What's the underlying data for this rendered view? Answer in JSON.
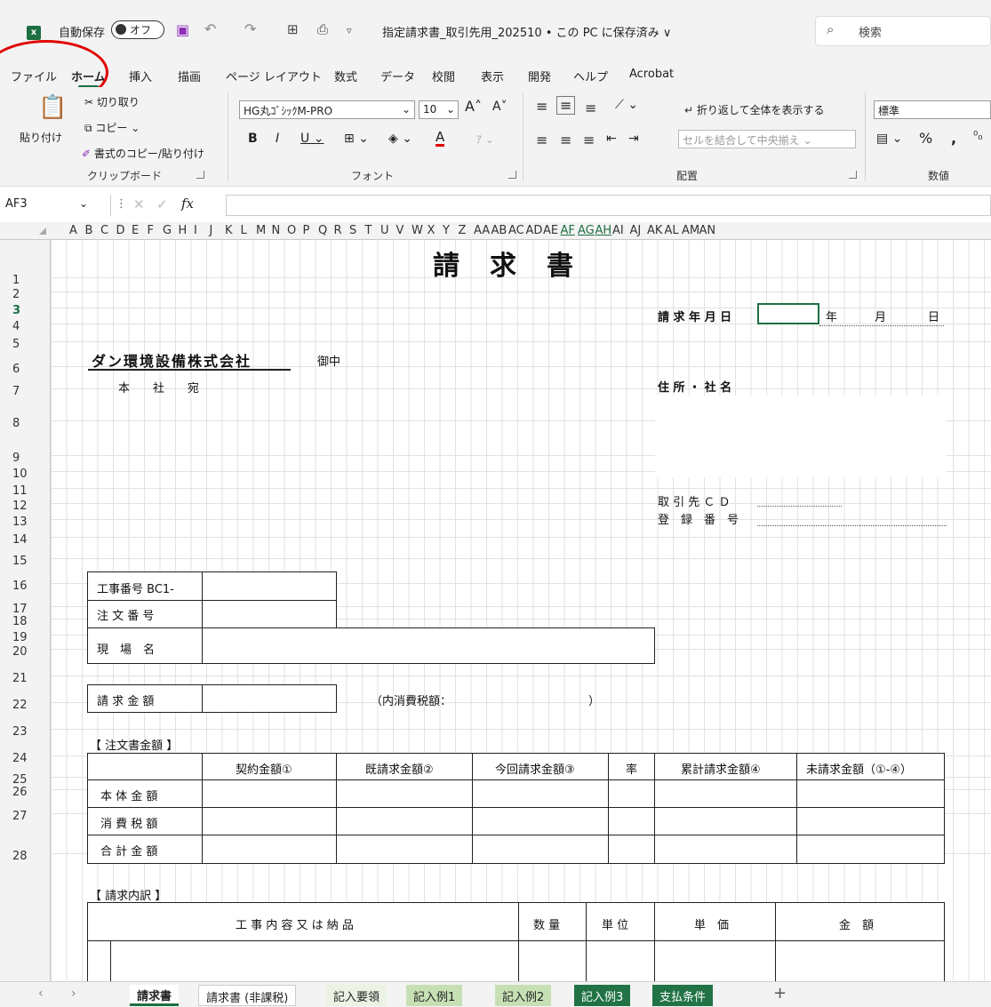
{
  "titlebar": {
    "autosave": "自動保存",
    "toggle": "オフ",
    "filename": "指定請求書_取引先用_202510 • この PC に保存済み ∨",
    "search": "検索"
  },
  "menu": [
    "ファイル",
    "ホーム",
    "挿入",
    "描画",
    "ページ レイアウト",
    "数式",
    "データ",
    "校閲",
    "表示",
    "開発",
    "ヘルプ",
    "Acrobat"
  ],
  "ribbon": {
    "paste": "貼り付け",
    "cut": "切り取り",
    "copy": "コピー",
    "format_painter": "書式のコピー/貼り付け",
    "clipboard": "クリップボード",
    "font_name": "HG丸ｺﾞｼｯｸM-PRO",
    "font_size": "10",
    "font_group": "フォント",
    "wrap": "折り返して全体を表示する",
    "merge": "セルを結合して中央揃え",
    "align_group": "配置",
    "number_format": "標準",
    "number_group": "数値"
  },
  "namebox": "AF3",
  "columns": [
    "A",
    "B",
    "C",
    "D",
    "E",
    "F",
    "G",
    "H",
    "I",
    "J",
    "K",
    "L",
    "M",
    "N",
    "O",
    "P",
    "Q",
    "R",
    "S",
    "T",
    "U",
    "V",
    "W",
    "X",
    "Y",
    "Z",
    "AA",
    "AB",
    "AC",
    "AD",
    "AE",
    "AF",
    "AG",
    "AH",
    "AI",
    "AJ",
    "AK",
    "AL",
    "AM",
    "AN"
  ],
  "rows": [
    "1",
    "2",
    "3",
    "4",
    "5",
    "6",
    "7",
    "8",
    "9",
    "10",
    "11",
    "12",
    "13",
    "14",
    "15",
    "16",
    "17",
    "18",
    "19",
    "20",
    "21",
    "22",
    "23",
    "24",
    "25",
    "26",
    "27",
    "28"
  ],
  "sheet": {
    "title": "請　求　書",
    "date_label": "請 求 年 月 日",
    "year": "年",
    "month": "月",
    "day": "日",
    "company": "ダン環境設備株式会社",
    "onchu": "御中",
    "honsha": "本　　社　　宛",
    "address_label": "住 所 ・ 社 名",
    "partner_cd": "取 引 先 Ｃ Ｄ",
    "reg_no": "登　録　番　号",
    "koji_no": "工事番号 BC1-",
    "order_no": "注 文 番 号",
    "site": "現　場　名",
    "amount": "請 求 金 額",
    "tax_note": "（内消費税額：",
    "tax_close": "）",
    "order_section": "【 注文書金額 】",
    "order_headers": [
      "契約金額①",
      "既請求金額②",
      "今回請求金額③",
      "率",
      "累計請求金額④",
      "未請求金額（①-④）"
    ],
    "order_rows": [
      "本 体 金 額",
      "消 費 税 額",
      "合 計 金 額"
    ],
    "detail_section": "【 請求内訳 】",
    "detail_headers": [
      "工 事 内 容 又 は 納 品",
      "数 量",
      "単 位",
      "単　価",
      "金　額"
    ]
  },
  "tabs": [
    "請求書",
    "請求書 (非課税)",
    "記入要領",
    "記入例1",
    "記入例2",
    "記入例3",
    "支払条件"
  ],
  "colors": {
    "accent": "#1d6f42",
    "annotation": "#e00000",
    "tab_green": "#c6e0b4",
    "tab_dark": "#217346"
  }
}
